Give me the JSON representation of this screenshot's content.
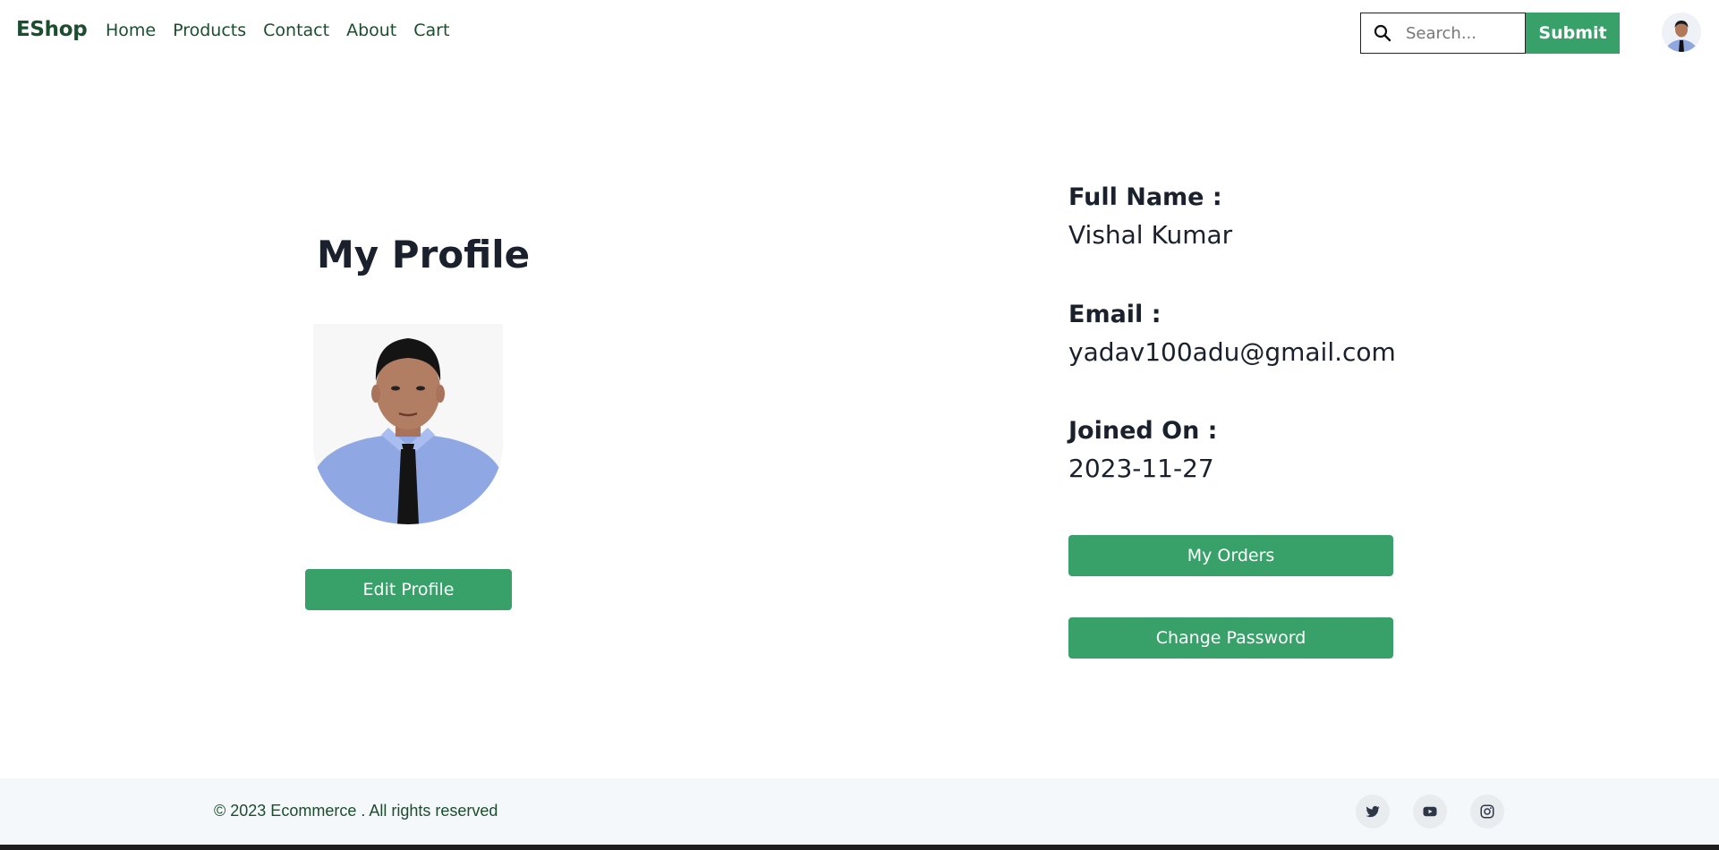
{
  "navbar": {
    "brand": "EShop",
    "links": [
      "Home",
      "Products",
      "Contact",
      "About",
      "Cart"
    ],
    "search": {
      "placeholder": "Search...",
      "value": ""
    },
    "submit_label": "Submit",
    "avatar_icon": "user-avatar-icon"
  },
  "profile": {
    "title": "My Profile",
    "photo_icon": "profile-photo-icon",
    "edit_label": "Edit Profile",
    "fields": [
      {
        "label": "Full Name :",
        "value": "Vishal Kumar"
      },
      {
        "label": "Email :",
        "value": "yadav100adu@gmail.com"
      },
      {
        "label": "Joined On :",
        "value": "2023-11-27"
      }
    ],
    "orders_label": "My Orders",
    "password_label": "Change Password"
  },
  "footer": {
    "copyright": "© 2023 Ecommerce . All rights reserved",
    "social": [
      "twitter-icon",
      "youtube-icon",
      "instagram-icon"
    ]
  },
  "colors": {
    "accent": "#38a169",
    "brand_text": "#1b4d2e",
    "footer_bg": "#f5f8fa"
  }
}
